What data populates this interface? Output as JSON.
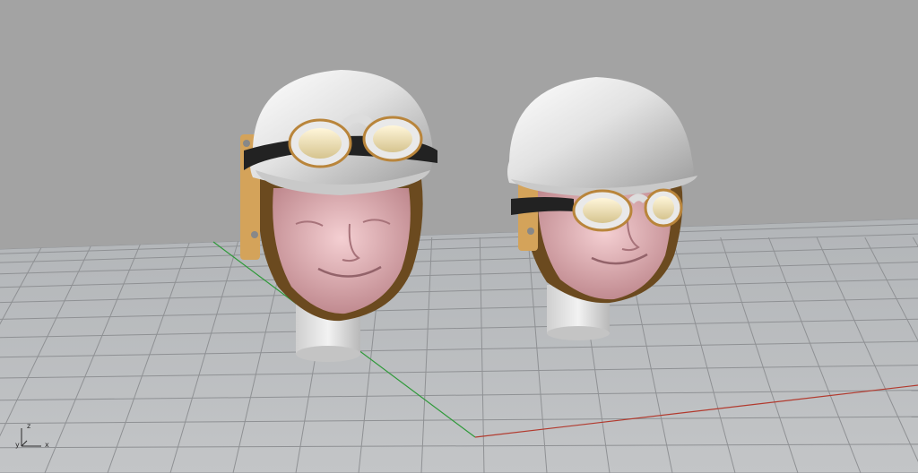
{
  "viewport": {
    "background": "#a3a3a3",
    "grid_color": "#8e8e8e",
    "grid_fill": "#b9bbbd",
    "x_axis_color": "#b23a2e",
    "y_axis_color": "#2f9a3a"
  },
  "axis_gizmo": {
    "z_label": "z",
    "y_label": "y",
    "x_label": "x"
  },
  "models": [
    {
      "name": "helmet-head-goggles-up",
      "helmet_color": "#e6e6e6",
      "skin_color": "#e6b3b6",
      "leather_color": "#6b4a1f",
      "strap_color": "#222222",
      "buckle_color": "#d4a35a"
    },
    {
      "name": "helmet-head-goggles-down",
      "helmet_color": "#e6e6e6",
      "skin_color": "#e6b3b6",
      "leather_color": "#6b4a1f",
      "strap_color": "#222222",
      "buckle_color": "#d4a35a"
    }
  ]
}
